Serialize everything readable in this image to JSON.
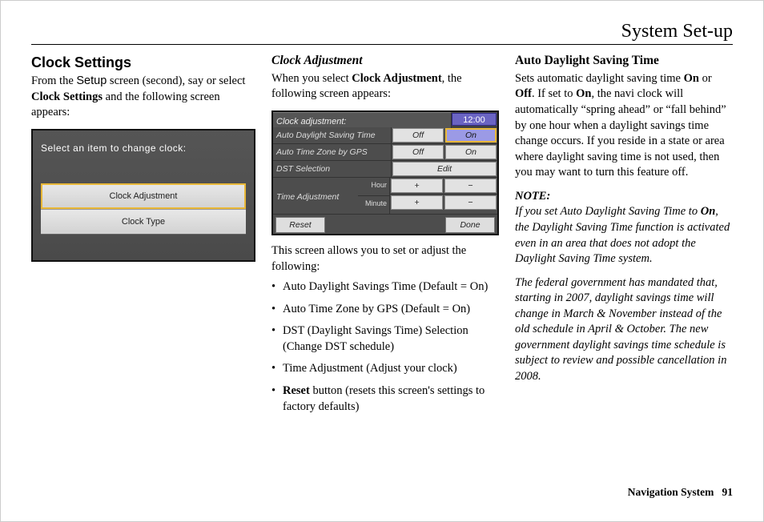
{
  "page_title": "System Set-up",
  "footer": {
    "label": "Navigation System",
    "num": "91"
  },
  "col1": {
    "heading": "Clock Settings",
    "intro_1": "From the ",
    "intro_setup": "Setup",
    "intro_2": " screen (second), say or select ",
    "intro_bold": "Clock Settings",
    "intro_3": " and the following screen appears:",
    "screen": {
      "title": "Select an item to change clock:",
      "item1": "Clock Adjustment",
      "item2": "Clock Type"
    }
  },
  "col2": {
    "heading": "Clock Adjustment",
    "p_1": "When you select ",
    "p_bold": "Clock Adjustment",
    "p_2": ", the following screen appears:",
    "screen": {
      "title": "Clock adjustment:",
      "clock": "12:00",
      "row1": "Auto Daylight Saving Time",
      "row2": "Auto Time Zone by GPS",
      "row3": "DST Selection",
      "row4": "Time Adjustment",
      "hour": "Hour",
      "minute": "Minute",
      "off": "Off",
      "on": "On",
      "edit": "Edit",
      "plus": "+",
      "minus": "−",
      "reset": "Reset",
      "done": "Done"
    },
    "after": "This screen allows you to set or adjust the following:",
    "bullets": {
      "b1": "Auto Daylight Savings Time (Default = On)",
      "b2": "Auto Time Zone by GPS (Default = On)",
      "b3": "DST (Daylight Savings Time) Selection (Change DST schedule)",
      "b4": "Time Adjustment (Adjust your clock)",
      "b5_pre": "Reset",
      "b5_post": " button (resets this screen's settings to factory defaults)"
    }
  },
  "col3": {
    "heading": "Auto Daylight Saving Time",
    "p1_a": "Sets automatic daylight saving time ",
    "p1_on": "On",
    "p1_b": " or ",
    "p1_off": "Off",
    "p1_c": ". If set to ",
    "p1_on2": "On",
    "p1_d": ", the navi clock will automatically “spring ahead” or “fall behind” by one hour when a daylight savings time change occurs. If you reside in a state or area where daylight saving time is not used, then you may want to turn this feature off.",
    "note_label": "NOTE:",
    "note1_a": "If you set Auto Daylight Saving Time to ",
    "note1_on": "On",
    "note1_b": ", the Daylight Saving Time function is activated even in an area that does not adopt the Daylight Saving Time system.",
    "note2": "The federal government has mandated that, starting in 2007, daylight savings time will change in March & November instead of the old schedule in April & October. The new government daylight savings time schedule is subject to review and possible cancellation in 2008."
  }
}
